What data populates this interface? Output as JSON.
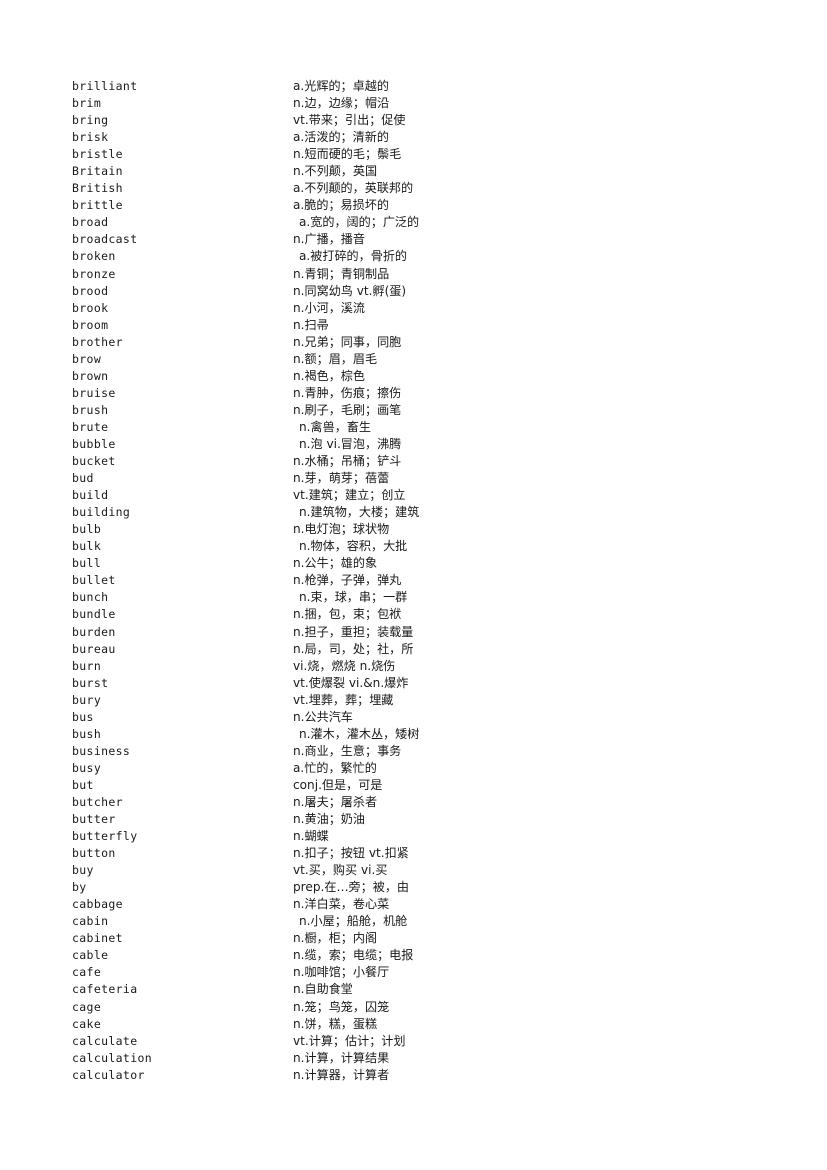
{
  "document": {
    "type": "vocabulary-list",
    "language_pair": "English-Chinese",
    "columns": [
      "term",
      "definition"
    ],
    "entries": [
      {
        "term": "brilliant",
        "definition": "a.光辉的；卓越的",
        "indent": false
      },
      {
        "term": "brim",
        "definition": "n.边，边缘；帽沿",
        "indent": false
      },
      {
        "term": "bring",
        "definition": "vt.带来；引出；促使",
        "indent": false
      },
      {
        "term": "brisk",
        "definition": "a.活泼的；清新的",
        "indent": false
      },
      {
        "term": "bristle",
        "definition": "n.短而硬的毛；鬃毛",
        "indent": false
      },
      {
        "term": "Britain",
        "definition": "n.不列颠，英国",
        "indent": false
      },
      {
        "term": "British",
        "definition": "a.不列颠的，英联邦的",
        "indent": false
      },
      {
        "term": "brittle",
        "definition": "a.脆的；易损坏的",
        "indent": false
      },
      {
        "term": "broad",
        "definition": "a.宽的，阔的；广泛的",
        "indent": true
      },
      {
        "term": "broadcast",
        "definition": "n.广播，播音",
        "indent": false
      },
      {
        "term": "broken",
        "definition": "a.被打碎的，骨折的",
        "indent": true
      },
      {
        "term": "bronze",
        "definition": "n.青铜；青铜制品",
        "indent": false
      },
      {
        "term": "brood",
        "definition": "n.同窝幼鸟 vt.孵(蛋)",
        "indent": false
      },
      {
        "term": "brook",
        "definition": "n.小河，溪流",
        "indent": false
      },
      {
        "term": "broom",
        "definition": "n.扫帚",
        "indent": false
      },
      {
        "term": "brother",
        "definition": "n.兄弟；同事，同胞",
        "indent": false
      },
      {
        "term": "brow",
        "definition": "n.额；眉，眉毛",
        "indent": false
      },
      {
        "term": "brown",
        "definition": "n.褐色，棕色",
        "indent": false
      },
      {
        "term": "bruise",
        "definition": "n.青肿，伤痕；擦伤",
        "indent": false
      },
      {
        "term": "brush",
        "definition": "n.刷子，毛刷；画笔",
        "indent": false
      },
      {
        "term": "brute",
        "definition": "n.禽兽，畜生",
        "indent": true
      },
      {
        "term": "bubble",
        "definition": "n.泡 vi.冒泡，沸腾",
        "indent": true
      },
      {
        "term": "bucket",
        "definition": "n.水桶；吊桶；铲斗",
        "indent": false
      },
      {
        "term": "bud",
        "definition": "n.芽，萌芽；蓓蕾",
        "indent": false
      },
      {
        "term": "build",
        "definition": "vt.建筑；建立；创立",
        "indent": false
      },
      {
        "term": "building",
        "definition": "n.建筑物，大楼；建筑",
        "indent": true
      },
      {
        "term": "bulb",
        "definition": "n.电灯泡；球状物",
        "indent": false
      },
      {
        "term": "bulk",
        "definition": "n.物体，容积，大批",
        "indent": true
      },
      {
        "term": "bull",
        "definition": "n.公牛；雄的象",
        "indent": false
      },
      {
        "term": "bullet",
        "definition": "n.枪弹，子弹，弹丸",
        "indent": false
      },
      {
        "term": "bunch",
        "definition": "n.束，球，串；一群",
        "indent": true
      },
      {
        "term": "bundle",
        "definition": "n.捆，包，束；包袱",
        "indent": false
      },
      {
        "term": "burden",
        "definition": "n.担子，重担；装载量",
        "indent": false
      },
      {
        "term": "bureau",
        "definition": "n.局，司，处；社，所",
        "indent": false
      },
      {
        "term": "burn",
        "definition": "vi.烧，燃烧 n.烧伤",
        "indent": false
      },
      {
        "term": "burst",
        "definition": "vt.使爆裂 vi.&n.爆炸",
        "indent": false
      },
      {
        "term": "bury",
        "definition": "vt.埋葬，葬；埋藏",
        "indent": false
      },
      {
        "term": "bus",
        "definition": "n.公共汽车",
        "indent": false
      },
      {
        "term": "bush",
        "definition": "n.灌木，灌木丛，矮树",
        "indent": true
      },
      {
        "term": "business",
        "definition": "n.商业，生意；事务",
        "indent": false
      },
      {
        "term": "busy",
        "definition": "a.忙的，繁忙的",
        "indent": false
      },
      {
        "term": "but",
        "definition": "conj.但是，可是",
        "indent": false
      },
      {
        "term": "butcher",
        "definition": "n.屠夫；屠杀者",
        "indent": false
      },
      {
        "term": "butter",
        "definition": "n.黄油；奶油",
        "indent": false
      },
      {
        "term": "butterfly",
        "definition": "n.蝴蝶",
        "indent": false
      },
      {
        "term": "button",
        "definition": "n.扣子；按钮 vt.扣紧",
        "indent": false
      },
      {
        "term": "buy",
        "definition": "vt.买，购买 vi.买",
        "indent": false
      },
      {
        "term": "by",
        "definition": "prep.在…旁；被，由",
        "indent": false
      },
      {
        "term": "cabbage",
        "definition": "n.洋白菜，卷心菜",
        "indent": false
      },
      {
        "term": "cabin",
        "definition": "n.小屋；船舱，机舱",
        "indent": true
      },
      {
        "term": "cabinet",
        "definition": "n.橱，柜；内阁",
        "indent": false
      },
      {
        "term": "cable",
        "definition": "n.缆，索；电缆；电报",
        "indent": false
      },
      {
        "term": "cafe",
        "definition": "n.咖啡馆；小餐厅",
        "indent": false
      },
      {
        "term": "cafeteria",
        "definition": "n.自助食堂",
        "indent": false
      },
      {
        "term": "cage",
        "definition": "n.笼；鸟笼，囚笼",
        "indent": false
      },
      {
        "term": "cake",
        "definition": "n.饼，糕，蛋糕",
        "indent": false
      },
      {
        "term": "calculate",
        "definition": "vt.计算；估计；计划",
        "indent": false
      },
      {
        "term": "calculation",
        "definition": "n.计算，计算结果",
        "indent": false
      },
      {
        "term": "calculator",
        "definition": "n.计算器，计算者",
        "indent": false
      }
    ]
  }
}
